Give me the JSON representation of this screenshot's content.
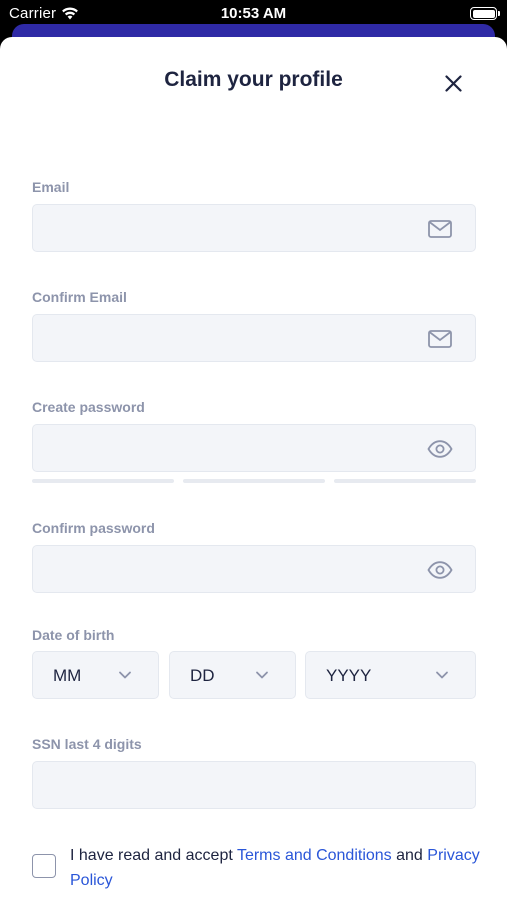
{
  "status_bar": {
    "carrier": "Carrier",
    "time": "10:53 AM"
  },
  "sheet": {
    "title": "Claim your profile",
    "close_icon": "close-icon"
  },
  "form": {
    "email": {
      "label": "Email",
      "value": "",
      "placeholder": "",
      "icon": "mail-icon"
    },
    "confirm_email": {
      "label": "Confirm Email",
      "value": "",
      "placeholder": "",
      "icon": "mail-icon"
    },
    "create_password": {
      "label": "Create password",
      "value": "",
      "placeholder": "",
      "icon": "eye-icon",
      "strength_segments": 3
    },
    "confirm_password": {
      "label": "Confirm password",
      "value": "",
      "placeholder": "",
      "icon": "eye-icon"
    },
    "date_of_birth": {
      "label": "Date of birth",
      "month": "MM",
      "day": "DD",
      "year": "YYYY"
    },
    "ssn": {
      "label": "SSN last 4 digits",
      "value": "",
      "placeholder": ""
    }
  },
  "consent": {
    "checked": false,
    "prefix": "I have read and accept ",
    "terms_link": "Terms and Conditions",
    "conjunction": " and ",
    "privacy_link": "Privacy Policy"
  },
  "colors": {
    "accent": "#2a56d8",
    "label": "#8d94ab",
    "title": "#1e2440",
    "field_bg": "#f3f5f9",
    "peek_bar": "#2f2aa6"
  }
}
